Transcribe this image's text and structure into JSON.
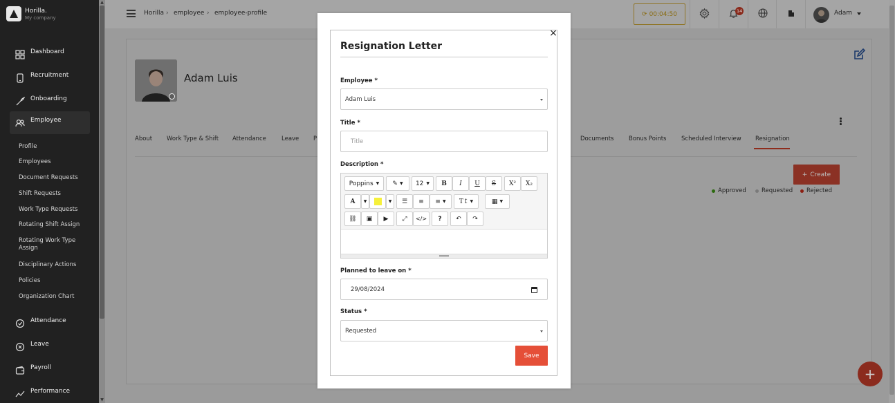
{
  "brand": {
    "name": "Horilla.",
    "company": "My company"
  },
  "sidebar": {
    "nav": [
      {
        "label": "Dashboard",
        "icon": "dashboard-icon"
      },
      {
        "label": "Recruitment",
        "icon": "recruitment-icon"
      },
      {
        "label": "Onboarding",
        "icon": "rocket-icon"
      },
      {
        "label": "Employee",
        "icon": "users-icon"
      }
    ],
    "employee_sub": [
      "Profile",
      "Employees",
      "Document Requests",
      "Shift Requests",
      "Work Type Requests",
      "Rotating Shift Assign",
      "Rotating Work Type Assign",
      "Disciplinary Actions",
      "Policies",
      "Organization Chart"
    ],
    "nav_bottom": [
      {
        "label": "Attendance",
        "icon": "attendance-icon"
      },
      {
        "label": "Leave",
        "icon": "leave-icon"
      },
      {
        "label": "Payroll",
        "icon": "wallet-icon"
      },
      {
        "label": "Performance",
        "icon": "chart-line-icon"
      }
    ]
  },
  "topbar": {
    "breadcrumb": [
      "Horilla",
      "employee",
      "employee-profile"
    ],
    "timer": "00:04:50",
    "notification_count": "14",
    "user_name": "Adam"
  },
  "profile": {
    "name": "Adam Luis"
  },
  "tabs": [
    "About",
    "Work Type & Shift",
    "Attendance",
    "Leave",
    "P",
    "Documents",
    "Bonus Points",
    "Scheduled Interview",
    "Resignation"
  ],
  "active_tab": "Resignation",
  "create_label": "Create",
  "legend": [
    "Approved",
    "Requested",
    "Rejected"
  ],
  "colors": {
    "accent": "#e54f38",
    "approved": "#2c6a0f",
    "requested": "#7a7a7a",
    "rejected": "#8b1e12"
  },
  "modal": {
    "title": "Resignation Letter",
    "employee_label": "Employee",
    "employee_value": "Adam Luis",
    "title_label": "Title",
    "title_placeholder": "Title",
    "description_label": "Description",
    "editor": {
      "font": "Poppins",
      "size": "12"
    },
    "planned_label": "Planned to leave on",
    "planned_value": "29/08/2024",
    "status_label": "Status",
    "status_value": "Requested",
    "save_label": "Save",
    "required_mark": "*"
  }
}
